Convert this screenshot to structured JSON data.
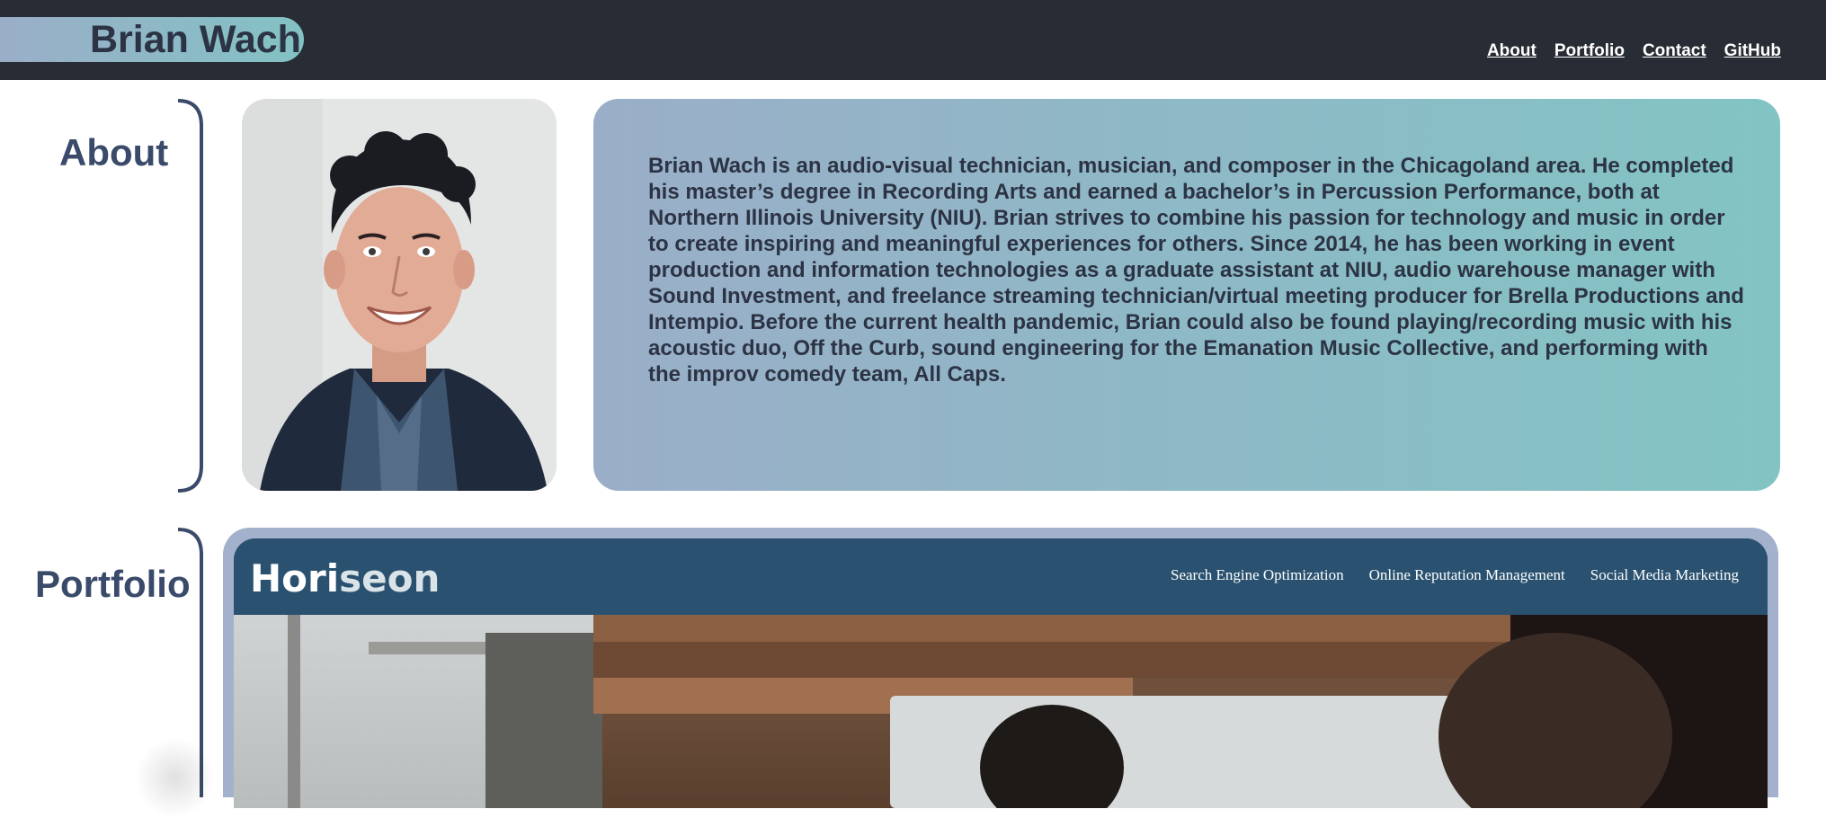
{
  "header": {
    "logo_text": "Brian Wach",
    "nav": [
      {
        "label": "About"
      },
      {
        "label": "Portfolio"
      },
      {
        "label": "Contact"
      },
      {
        "label": "GitHub"
      }
    ]
  },
  "about": {
    "title": "About",
    "bio": "Brian Wach is an audio-visual technician, musician, and composer in the Chicagoland area. He completed his master’s degree in Recording Arts and earned a bachelor’s in Percussion Performance, both at Northern Illinois University (NIU). Brian strives to combine his passion for technology and music in order to create inspiring and meaningful experiences for others. Since 2014, he has been working in event production and information technologies as a graduate assistant at NIU, audio warehouse manager with Sound Investment, and freelance streaming technician/virtual meeting producer for Brella Productions and Intempio. Before the current health pandemic, Brian could also be found playing/recording music with his acoustic duo, Off the Curb, sound engineering for the Emanation Music Collective, and performing with the improv comedy team, All Caps."
  },
  "portfolio": {
    "title": "Portfolio",
    "project": {
      "brand_left": "Hori",
      "brand_right": "seon",
      "nav": [
        {
          "label": "Search Engine Optimization"
        },
        {
          "label": "Online Reputation Management"
        },
        {
          "label": "Social Media Marketing"
        }
      ]
    }
  },
  "colors": {
    "header_bg": "#282c34",
    "accent_gradient_start": "#9aaec8",
    "accent_gradient_end": "#82c4c4",
    "title_color": "#3a4a6a",
    "project_header_bg": "#2a5270"
  }
}
